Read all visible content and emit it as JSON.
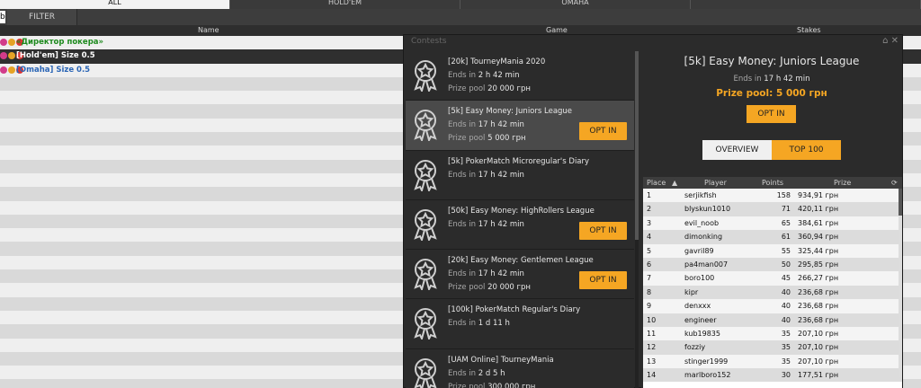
{
  "top_tabs": [
    "ALL",
    "HOLD'EM",
    "OMAHA",
    ""
  ],
  "filter": {
    "label": "FILTER",
    "left_fragment": "b"
  },
  "columns": {
    "name": "Name",
    "game": "Game",
    "stakes": "Stakes"
  },
  "lobby_rows": [
    {
      "label": "«Директор покера»",
      "style": "green"
    },
    {
      "label": "[Hold'em] Size 0.5",
      "style": "selected"
    },
    {
      "label": "[Omaha] Size 0.5",
      "style": "blue"
    }
  ],
  "contests_panel": {
    "title": "Contests",
    "controls": "⌂ ✕",
    "items": [
      {
        "name": "[20k] TourneyMania 2020",
        "ends_label": "Ends in",
        "ends_value": "2 h 42 min",
        "prize_label": "Prize pool",
        "prize_value": "20 000 грн",
        "opt_in": ""
      },
      {
        "name": "[5k] Easy Money: Juniors League",
        "ends_label": "Ends in",
        "ends_value": "17 h 42 min",
        "prize_label": "Prize pool",
        "prize_value": "5 000 грн",
        "opt_in": "OPT IN"
      },
      {
        "name": "[5k] PokerMatch Microregular's Diary",
        "ends_label": "Ends in",
        "ends_value": "17 h 42 min",
        "prize_label": "",
        "prize_value": "",
        "opt_in": ""
      },
      {
        "name": "[50k] Easy Money: HighRollers League",
        "ends_label": "Ends in",
        "ends_value": "17 h 42 min",
        "prize_label": "",
        "prize_value": "",
        "opt_in": "OPT IN"
      },
      {
        "name": "[20k] Easy Money: Gentlemen League",
        "ends_label": "Ends in",
        "ends_value": "17 h 42 min",
        "prize_label": "Prize pool",
        "prize_value": "20 000 грн",
        "opt_in": "OPT IN"
      },
      {
        "name": "[100k] PokerMatch Regular's Diary",
        "ends_label": "Ends in",
        "ends_value": "1 d 11 h",
        "prize_label": "",
        "prize_value": "",
        "opt_in": ""
      },
      {
        "name": "[UAM Online] TourneyMania",
        "ends_label": "Ends in",
        "ends_value": "2 d 5 h",
        "prize_label": "Prize pool",
        "prize_value": "300 000 грн",
        "opt_in": ""
      }
    ],
    "detail": {
      "title": "[5k] Easy Money: Juniors League",
      "ends_label": "Ends in",
      "ends_value": "17 h 42 min",
      "prize": "Prize pool: 5 000 грн",
      "opt_in": "OPT IN",
      "tab_overview": "OVERVIEW",
      "tab_top": "TOP 100",
      "table_headers": {
        "place": "Place",
        "player": "Player",
        "points": "Points",
        "prize": "Prize"
      },
      "leaderboard": [
        {
          "place": "1",
          "player": "serjikfish",
          "points": "158",
          "prize": "934,91 грн"
        },
        {
          "place": "2",
          "player": "blyskun1010",
          "points": "71",
          "prize": "420,11 грн"
        },
        {
          "place": "3",
          "player": "evil_noob",
          "points": "65",
          "prize": "384,61 грн"
        },
        {
          "place": "4",
          "player": "dimonking",
          "points": "61",
          "prize": "360,94 грн"
        },
        {
          "place": "5",
          "player": "gavril89",
          "points": "55",
          "prize": "325,44 грн"
        },
        {
          "place": "6",
          "player": "pa4man007",
          "points": "50",
          "prize": "295,85 грн"
        },
        {
          "place": "7",
          "player": "boro100",
          "points": "45",
          "prize": "266,27 грн"
        },
        {
          "place": "8",
          "player": "kipr",
          "points": "40",
          "prize": "236,68 грн"
        },
        {
          "place": "9",
          "player": "denxxx",
          "points": "40",
          "prize": "236,68 грн"
        },
        {
          "place": "10",
          "player": "engineer",
          "points": "40",
          "prize": "236,68 грн"
        },
        {
          "place": "11",
          "player": "kub19835",
          "points": "35",
          "prize": "207,10 грн"
        },
        {
          "place": "12",
          "player": "fozziy",
          "points": "35",
          "prize": "207,10 грн"
        },
        {
          "place": "13",
          "player": "stinger1999",
          "points": "35",
          "prize": "207,10 грн"
        },
        {
          "place": "14",
          "player": "marlboro152",
          "points": "30",
          "prize": "177,51 грн"
        }
      ]
    }
  },
  "colors": {
    "accent": "#f5a623",
    "panel": "#2b2b2b",
    "green_text": "#1d8a1d",
    "blue_text": "#2a65b5"
  }
}
